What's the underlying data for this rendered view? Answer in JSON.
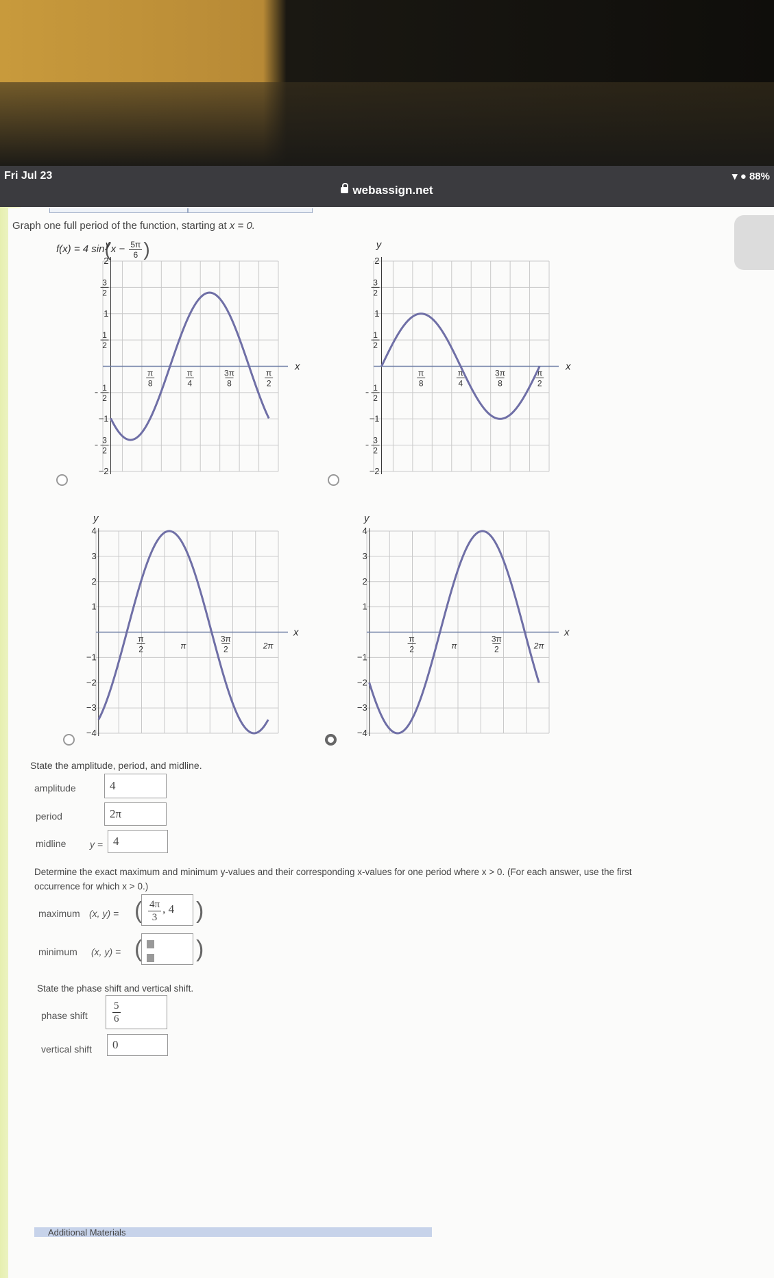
{
  "status": {
    "time": "Fri Jul 23",
    "battery": "88%",
    "url": "webassign.net"
  },
  "question": {
    "prompt_pre": "Graph one full period of the function, starting at ",
    "prompt_var": "x = 0.",
    "function_pre": "f(x) = 4 sin",
    "function_x": "x −",
    "function_num": "5π",
    "function_den": "6"
  },
  "graphs": [
    {
      "y_labels": [
        "2",
        "1",
        "−1",
        "−2"
      ],
      "y_frac_labels": [
        [
          "3",
          "2"
        ],
        [
          "1",
          "2"
        ],
        [
          "1",
          "2"
        ],
        [
          "3",
          "2"
        ]
      ],
      "y_frac_negative": [
        false,
        false,
        true,
        true
      ],
      "x_labels": [
        [
          "π",
          "8"
        ],
        [
          "π",
          "4"
        ],
        [
          "3π",
          "8"
        ],
        [
          "π",
          "2"
        ]
      ],
      "axis_x": "x",
      "axis_y": "y"
    },
    {
      "y_labels": [
        "2",
        "1",
        "−1",
        "−2"
      ],
      "y_frac_labels": [
        [
          "3",
          "2"
        ],
        [
          "1",
          "2"
        ],
        [
          "1",
          "2"
        ],
        [
          "3",
          "2"
        ]
      ],
      "y_frac_negative": [
        false,
        false,
        true,
        true
      ],
      "x_labels": [
        [
          "π",
          "8"
        ],
        [
          "π",
          "4"
        ],
        [
          "3π",
          "8"
        ],
        [
          "π",
          "2"
        ]
      ],
      "axis_x": "x",
      "axis_y": "y"
    },
    {
      "y_labels": [
        "4",
        "3",
        "2",
        "1",
        "−1",
        "−2",
        "−3",
        "−4"
      ],
      "x_frac_labels": [
        [
          "π",
          "2"
        ],
        [
          "3π",
          "2"
        ]
      ],
      "x_text_labels": [
        "π",
        "2π"
      ],
      "axis_x": "x",
      "axis_y": "y"
    },
    {
      "y_labels": [
        "4",
        "3",
        "2",
        "1",
        "−1",
        "−2",
        "−3",
        "−4"
      ],
      "x_frac_labels": [
        [
          "π",
          "2"
        ],
        [
          "3π",
          "2"
        ]
      ],
      "x_text_labels": [
        "π",
        "2π"
      ],
      "axis_x": "x",
      "axis_y": "y"
    }
  ],
  "section1": {
    "heading": "State the amplitude, period, and midline.",
    "amplitude_label": "amplitude",
    "amplitude_value": "4",
    "period_label": "period",
    "period_value": "2π",
    "midline_label": "midline",
    "midline_prefix": "y =",
    "midline_value": "4"
  },
  "section2": {
    "heading_line1": "Determine the exact maximum and minimum y-values and their corresponding x-values for one period where  x > 0.  (For each answer, use the first",
    "heading_line2": "occurrence for which  x > 0.)",
    "maximum_label": "maximum",
    "xy_label": "(x, y) =",
    "max_x_num": "4π",
    "max_x_den": "3",
    "max_y": ", 4",
    "minimum_label": "minimum"
  },
  "section3": {
    "heading": "State the phase shift and vertical shift.",
    "phase_label": "phase shift",
    "phase_num": "5",
    "phase_den": "6",
    "vertical_label": "vertical shift",
    "vertical_value": "0"
  },
  "footer": {
    "label": "Additional Materials"
  },
  "selected_option": 4
}
